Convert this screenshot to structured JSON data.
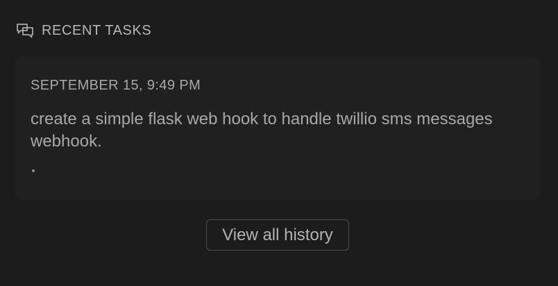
{
  "section": {
    "title": "RECENT TASKS",
    "icon": "chat-bubbles-icon"
  },
  "tasks": [
    {
      "date": "SEPTEMBER 15, 9:49 PM",
      "text": "create a simple flask web hook to handle twillio sms messages webhook."
    }
  ],
  "actions": {
    "view_all_history": "View all history"
  },
  "colors": {
    "background": "#1c1c1d",
    "card": "#202021",
    "text": "#a8a8aa",
    "button_border": "#4d4d50"
  }
}
